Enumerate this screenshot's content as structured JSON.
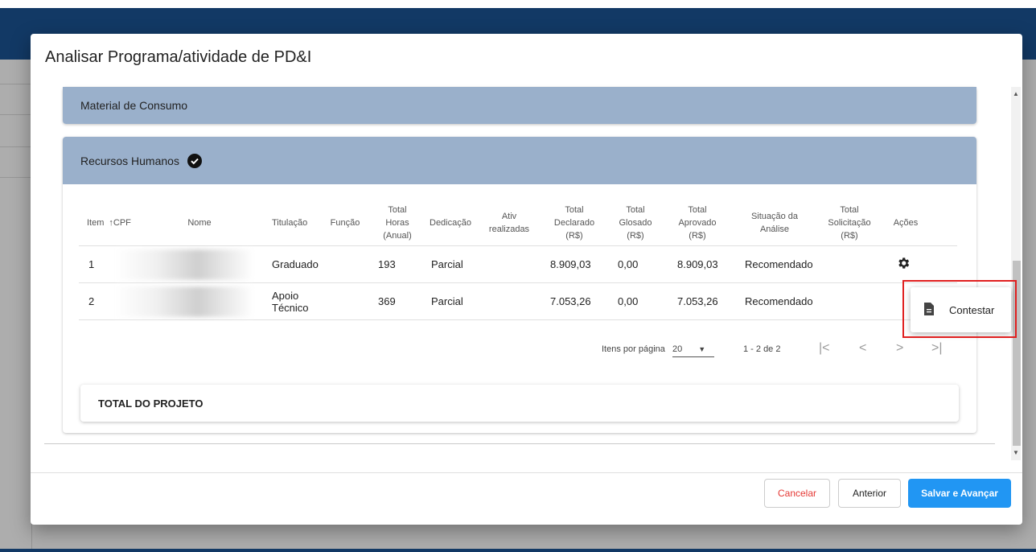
{
  "dialog": {
    "title": "Analisar Programa/atividade de PD&I"
  },
  "panels": {
    "material": "Material de Consumo",
    "rh": "Recursos Humanos"
  },
  "table": {
    "headers": {
      "item": "Item",
      "cpf": "CPF",
      "nome": "Nome",
      "titulacao": "Titulação",
      "funcao": "Função",
      "horas": [
        "Total",
        "Horas",
        "(Anual)"
      ],
      "dedicacao": "Dedicação",
      "ativ": [
        "Ativ",
        "realizadas"
      ],
      "declarado": [
        "Total",
        "Declarado",
        "(R$)"
      ],
      "glosado": [
        "Total",
        "Glosado",
        "(R$)"
      ],
      "aprovado": [
        "Total",
        "Aprovado",
        "(R$)"
      ],
      "situacao": [
        "Situação da",
        "Análise"
      ],
      "solicitacao": [
        "Total",
        "Solicitação",
        "(R$)"
      ],
      "acoes": "Ações"
    },
    "sort_arrow": "↑",
    "rows": [
      {
        "item": "1",
        "titulacao": [
          "Graduado"
        ],
        "horas": "193",
        "dedicacao": "Parcial",
        "declarado": "8.909,03",
        "glosado": "0,00",
        "aprovado": "8.909,03",
        "situacao": "Recomendado"
      },
      {
        "item": "2",
        "titulacao": [
          "Apoio",
          "Técnico"
        ],
        "horas": "369",
        "dedicacao": "Parcial",
        "declarado": "7.053,26",
        "glosado": "0,00",
        "aprovado": "7.053,26",
        "situacao": "Recomendado"
      }
    ]
  },
  "paginator": {
    "items_label": "Itens por página",
    "page_size": "20",
    "range": "1 - 2 de 2",
    "icons": [
      "first-page-icon",
      "prev-page-icon",
      "next-page-icon",
      "last-page-icon"
    ]
  },
  "total": "TOTAL DO PROJETO",
  "menu": {
    "item": "Contestar",
    "icon": "document-icon"
  },
  "buttons": {
    "cancel": "Cancelar",
    "prev": "Anterior",
    "save": "Salvar e Avançar"
  },
  "colors": {
    "panel_header": "#9ab0cb",
    "primary": "#2196f3",
    "cancel_text": "#e53935",
    "highlight": "#e02020"
  }
}
